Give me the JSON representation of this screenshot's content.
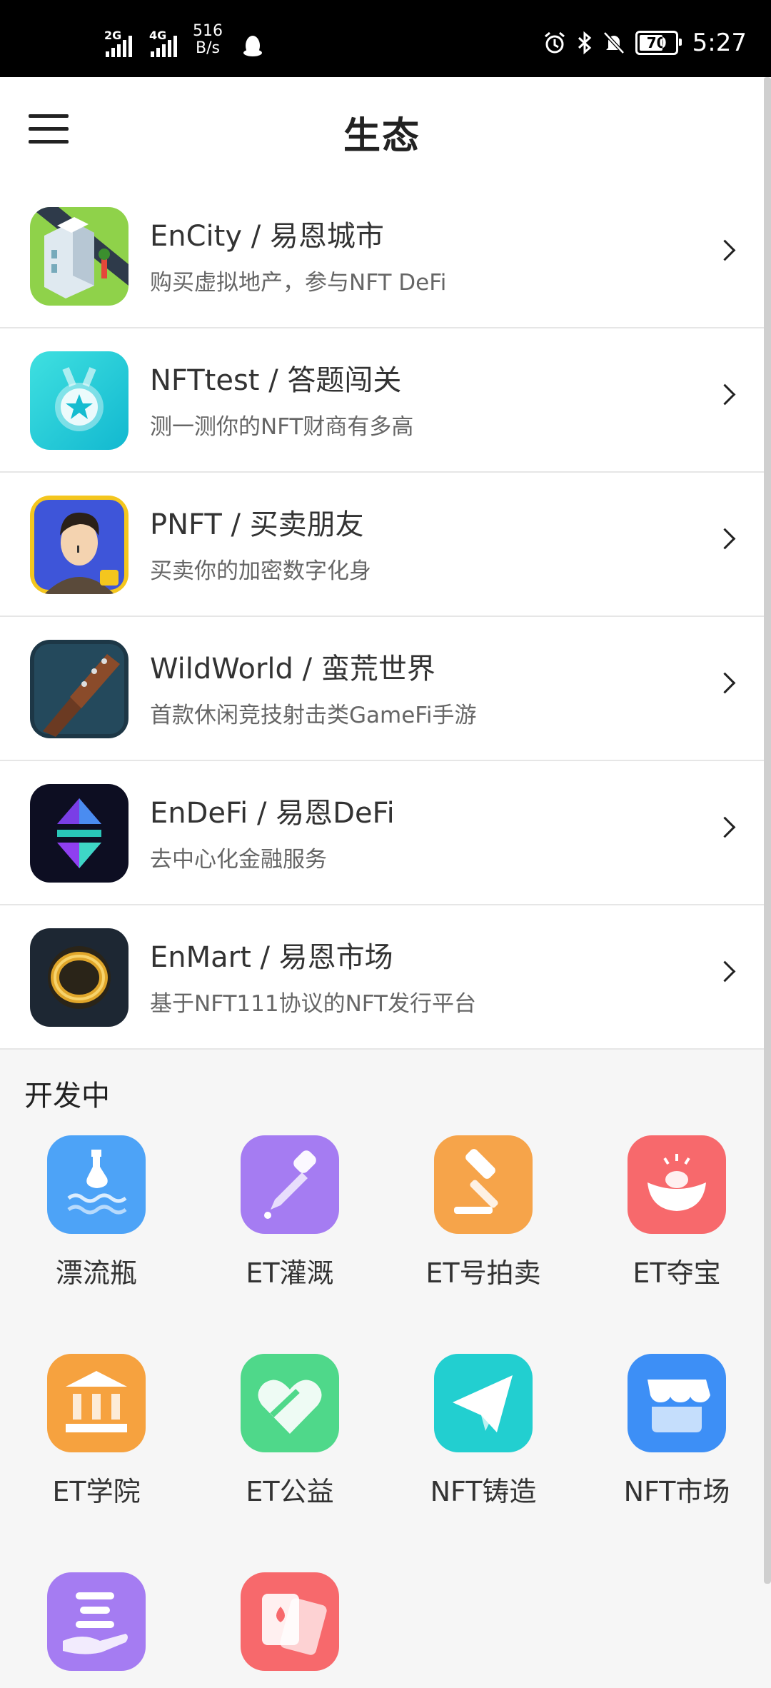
{
  "status_bar": {
    "network_1": "2G",
    "network_2": "4G",
    "speed_value": "516",
    "speed_unit": "B/s",
    "battery": "70",
    "time": "5:27"
  },
  "header": {
    "title": "生态"
  },
  "ecosystem": [
    {
      "title": "EnCity / 易恩城市",
      "subtitle": "购买虚拟地产，参与NFT DeFi",
      "icon": "city-building-icon"
    },
    {
      "title": "NFTtest / 答题闯关",
      "subtitle": "测一测你的NFT财商有多高",
      "icon": "medal-star-icon"
    },
    {
      "title": "PNFT / 买卖朋友",
      "subtitle": "买卖你的加密数字化身",
      "icon": "avatar-portrait-icon"
    },
    {
      "title": "WildWorld / 蛮荒世界",
      "subtitle": "首款休闲竞技射击类GameFi手游",
      "icon": "spiked-club-icon"
    },
    {
      "title": "EnDeFi / 易恩DeFi",
      "subtitle": "去中心化金融服务",
      "icon": "defi-logo-icon"
    },
    {
      "title": "EnMart / 易恩市场",
      "subtitle": "基于NFT111协议的NFT发行平台",
      "icon": "gold-ring-icon"
    }
  ],
  "dev_section": {
    "title": "开发中",
    "items": [
      {
        "label": "漂流瓶",
        "icon": "drift-bottle-icon",
        "color": "#4da3f7"
      },
      {
        "label": "ET灌溉",
        "icon": "dropper-icon",
        "color": "#a57cf2"
      },
      {
        "label": "ET号拍卖",
        "icon": "auction-hammer-icon",
        "color": "#f6a44a"
      },
      {
        "label": "ET夺宝",
        "icon": "treasure-ingot-icon",
        "color": "#f7696c"
      },
      {
        "label": "ET学院",
        "icon": "academy-building-icon",
        "color": "#f6a23f"
      },
      {
        "label": "ET公益",
        "icon": "charity-heart-icon",
        "color": "#4fd88a"
      },
      {
        "label": "NFT铸造",
        "icon": "paper-plane-icon",
        "color": "#22cfd0"
      },
      {
        "label": "NFT市场",
        "icon": "shop-icon",
        "color": "#3d8ff6"
      },
      {
        "label": "",
        "icon": "hand-list-icon",
        "color": "#a57cf2"
      },
      {
        "label": "",
        "icon": "playing-cards-icon",
        "color": "#f7696c"
      }
    ]
  }
}
